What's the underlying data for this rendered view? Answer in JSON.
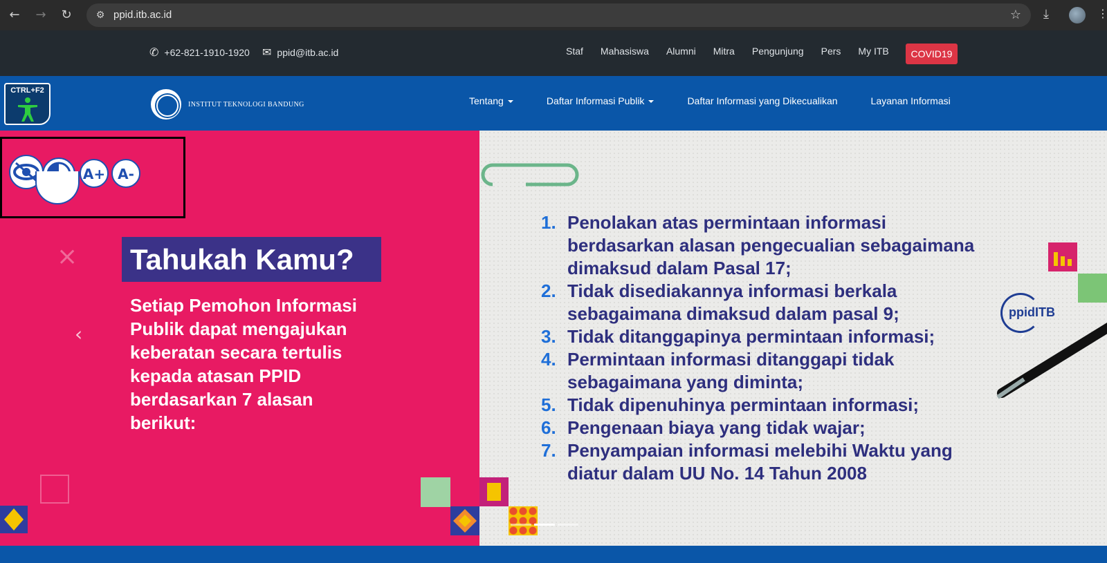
{
  "browser": {
    "url": "ppid.itb.ac.id",
    "icons": [
      "back-icon",
      "forward-icon",
      "reload-icon",
      "site-settings-icon",
      "bookmark-star-icon",
      "download-icon",
      "profile-icon",
      "menu-icon"
    ]
  },
  "topbar": {
    "phone": "+62-821-1910-1920",
    "email": "ppid@itb.ac.id",
    "links": [
      "Staf",
      "Mahasiswa",
      "Alumni",
      "Mitra",
      "Pengunjung",
      "Pers",
      "My ITB"
    ],
    "covid_button": "COVID19"
  },
  "accessibility_button": {
    "label": "CTRL+F2"
  },
  "brand": {
    "name": "INSTITUT TEKNOLOGI BANDUNG"
  },
  "nav": {
    "items": [
      {
        "label": "Tentang",
        "dropdown": true
      },
      {
        "label": "Daftar Informasi Publik",
        "dropdown": true
      },
      {
        "label": "Daftar Informasi yang Dikecualikan",
        "dropdown": false
      },
      {
        "label": "Layanan Informasi",
        "dropdown": false
      }
    ]
  },
  "a11y_tools": {
    "increase_label": "A+",
    "decrease_label": "A-"
  },
  "hero": {
    "headline": "Tahukah Kamu?",
    "subtext": "Setiap Pemohon Informasi Publik dapat mengajukan keberatan secara tertulis kepada atasan PPID berdasarkan 7 alasan berikut:",
    "logo": "ppidITB",
    "list": [
      {
        "num": "1.",
        "text": "Penolakan atas permintaan informasi berdasarkan alasan pengecualian sebagaimana dimaksud dalam Pasal 17;"
      },
      {
        "num": "2.",
        "text": "Tidak disediakannya informasi berkala sebagaimana dimaksud dalam pasal 9;"
      },
      {
        "num": "3.",
        "text": "Tidak ditanggapinya permintaan informasi;"
      },
      {
        "num": "4.",
        "text": "Permintaan informasi ditanggapi tidak sebagaimana yang diminta;"
      },
      {
        "num": "5.",
        "text": "Tidak dipenuhinya permintaan informasi;"
      },
      {
        "num": "6.",
        "text": "Pengenaan biaya yang tidak wajar;"
      },
      {
        "num": "7.",
        "text": "Penyampaian informasi melebihi Waktu yang diatur dalam UU No. 14 Tahun 2008"
      }
    ],
    "slide_count": 3,
    "active_slide": 2
  },
  "colors": {
    "chrome": "#2b2b2b",
    "topbar": "#232a30",
    "nav": "#0a56a8",
    "hero_left": "#e81a63",
    "headline_bg": "#3b3288",
    "list_text": "#2e2f7e",
    "covid": "#dc3545"
  }
}
